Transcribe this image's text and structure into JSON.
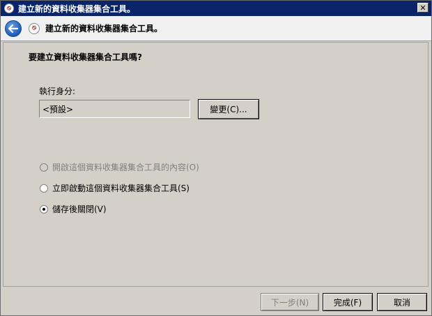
{
  "window": {
    "title": "建立新的資料收集器集合工具。",
    "close_glyph": "✕"
  },
  "header": {
    "title": "建立新的資料收集器集合工具。"
  },
  "main": {
    "question": "要建立資料收集器集合工具嗎?",
    "run_as_label": "執行身分:",
    "run_as_value": "<預設>",
    "change_button": "變更(C)...",
    "options": [
      {
        "label": "開啟這個資料收集器集合工具的內容(O)",
        "selected": false,
        "enabled": false
      },
      {
        "label": "立即啟動這個資料收集器集合工具(S)",
        "selected": false,
        "enabled": true
      },
      {
        "label": "儲存後關閉(V)",
        "selected": true,
        "enabled": true
      }
    ]
  },
  "footer": {
    "next_label": "下一步(N)",
    "finish_label": "完成(F)",
    "cancel_label": "取消"
  }
}
